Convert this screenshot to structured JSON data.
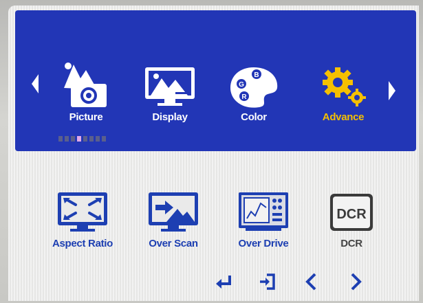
{
  "menu": {
    "categories": [
      {
        "label": "Picture",
        "icon": "picture-icon"
      },
      {
        "label": "Display",
        "icon": "display-icon"
      },
      {
        "label": "Color",
        "icon": "color-palette-icon"
      },
      {
        "label": "Advance",
        "icon": "gears-icon",
        "active": true
      }
    ],
    "page_indicator": {
      "total": 8,
      "active_index": 3
    }
  },
  "advance_items": [
    {
      "label": "Aspect Ratio",
      "icon": "aspect-ratio-icon"
    },
    {
      "label": "Over Scan",
      "icon": "over-scan-icon"
    },
    {
      "label": "Over Drive",
      "icon": "over-drive-icon"
    },
    {
      "label": "DCR",
      "icon": "dcr-icon",
      "icon_text": "DCR"
    }
  ],
  "controls": [
    "enter-icon",
    "exit-icon",
    "left-arrow-icon",
    "right-arrow-icon"
  ],
  "colors": {
    "band": "#2236b6",
    "active_label": "#f5c000",
    "item_blue": "#1d3fb2",
    "panel": "#ececeb"
  }
}
